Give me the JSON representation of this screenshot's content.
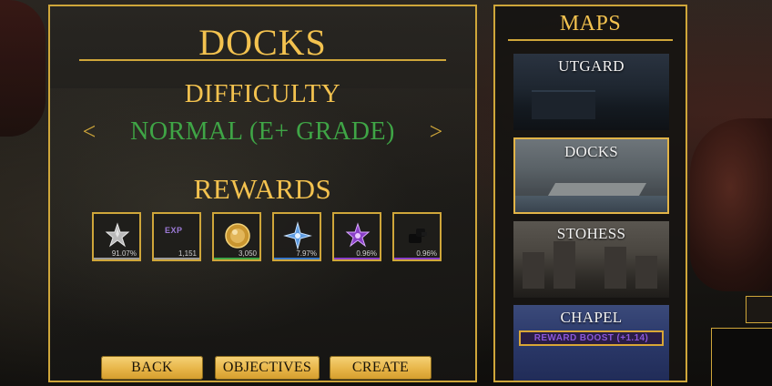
{
  "main": {
    "title": "DOCKS",
    "difficulty_label": "DIFFICULTY",
    "difficulty_value": "NORMAL (E+ GRADE)",
    "prev_arrow": "<",
    "next_arrow": ">",
    "rewards_label": "REWARDS",
    "rewards": [
      {
        "icon": "silver-star-emblem-icon",
        "value": "91.07%",
        "bar_color": "#9a9a9a"
      },
      {
        "icon": "exp-icon",
        "label": "EXP",
        "value": "1,151",
        "bar_color": "#9a9a9a"
      },
      {
        "icon": "gold-coin-icon",
        "value": "3,050",
        "bar_color": "#3fa546"
      },
      {
        "icon": "blue-star-emblem-icon",
        "value": "7.97%",
        "bar_color": "#3a78c8"
      },
      {
        "icon": "purple-star-emblem-icon",
        "value": "0.96%",
        "bar_color": "#8a3fc8"
      },
      {
        "icon": "dark-gear-item-icon",
        "value": "0.96%",
        "bar_color": "#8a3fc8"
      }
    ],
    "buttons": {
      "back": "BACK",
      "objectives": "OBJECTIVES",
      "create": "CREATE"
    }
  },
  "maps": {
    "title": "MAPS",
    "items": [
      {
        "name": "UTGARD",
        "selected": false
      },
      {
        "name": "DOCKS",
        "selected": true
      },
      {
        "name": "STOHESS",
        "selected": false
      },
      {
        "name": "CHAPEL",
        "selected": false,
        "banner": "REWARD BOOST (+1.14)"
      }
    ]
  },
  "colors": {
    "accent_gold": "#cfa63a",
    "title_gold": "#f3c24f",
    "difficulty_green": "#3fa546",
    "boost_purple": "#8c57d8"
  }
}
